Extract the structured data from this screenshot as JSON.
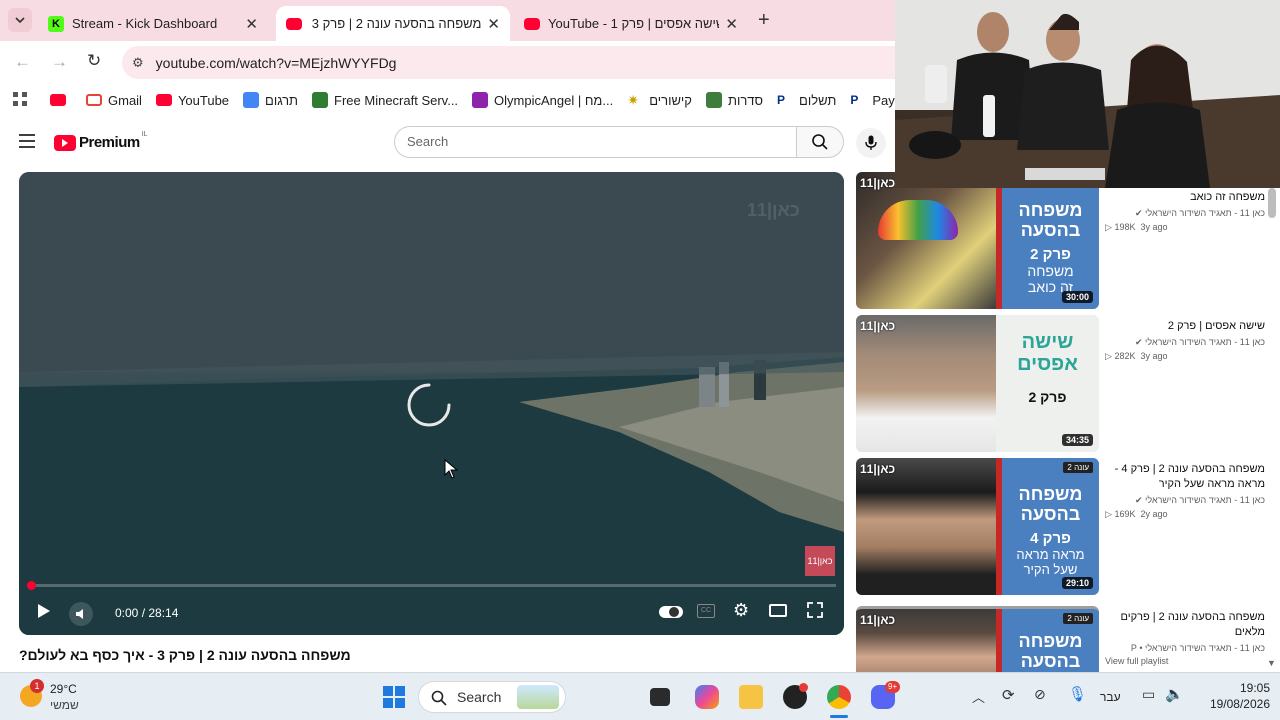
{
  "browser": {
    "tabs": [
      {
        "title": "Stream - Kick Dashboard",
        "color": "#53fc18"
      },
      {
        "title": "משפחה בהסעה עונה 2 | פרק 3",
        "color": "#ff0033"
      },
      {
        "title": "YouTube - שישה אפסים | פרק 1",
        "color": "#ff0033"
      }
    ],
    "url": "youtube.com/watch?v=MEjzhWYYFDg",
    "bookmarks": [
      {
        "label": "",
        "color": "#ff0033"
      },
      {
        "label": "Gmail",
        "color": "#ea4335"
      },
      {
        "label": "YouTube",
        "color": "#ff0033"
      },
      {
        "label": "תרגום",
        "color": "#4285f4"
      },
      {
        "label": "Free Minecraft Serv...",
        "color": "#2e7d32"
      },
      {
        "label": "OlympicAngel | מח...",
        "color": "#8e24aa"
      },
      {
        "label": "קישורים",
        "color": "#c8a200"
      },
      {
        "label": "סדרות",
        "color": "#3f7d3f"
      },
      {
        "label": "תשלום",
        "color": "#003087"
      },
      {
        "label": "Payl",
        "color": "#003087"
      }
    ]
  },
  "youtube": {
    "logo": "Premium",
    "logo_region": "IL",
    "search_placeholder": "Search",
    "player": {
      "time": "0:00 / 28:14",
      "watermark": "כאן|11",
      "corner_badge": "כאן|11"
    },
    "video_title": "משפחה בהסעה עונה 2 | פרק 3 - איך כסף בא לעולם?",
    "related": [
      {
        "title": "משפחה זה כואב",
        "channel": "כאן 11 - תאגיד השידור הישראלי",
        "views": "198K",
        "age": "3y ago",
        "duration": "30:00",
        "thumb_text": [
          "משפחה",
          "בהסעה",
          "פרק 2",
          "משפחה",
          "זה כואב"
        ],
        "badge": "",
        "logo": "כאן|11"
      },
      {
        "title": "שישה אפסים | פרק 2",
        "channel": "כאן 11 - תאגיד השידור הישראלי",
        "views": "282K",
        "age": "3y ago",
        "duration": "34:35",
        "thumb_text": [
          "שישה",
          "אפסים",
          "פרק 2"
        ],
        "badge": "",
        "logo": "כאן|11"
      },
      {
        "title": "משפחה בהסעה עונה 2 | פרק 4 - מראה מראה שעל הקיר",
        "channel": "כאן 11 - תאגיד השידור הישראלי",
        "views": "169K",
        "age": "2y ago",
        "duration": "29:10",
        "thumb_text": [
          "משפחה",
          "בהסעה",
          "פרק 4",
          "מראה מראה",
          "שעל הקיר"
        ],
        "badge": "עונה 2",
        "logo": "כאן|11"
      },
      {
        "title": "משפחה בהסעה עונה 2 | פרקים מלאים",
        "channel": "כאן 11 - תאגיד השידור הישראלי • P",
        "views": "",
        "age": "",
        "duration": "",
        "thumb_text": [
          "משפחה",
          "בהסעה"
        ],
        "badge": "עונה 2",
        "logo": "כאן|11",
        "footer": "View full playlist"
      }
    ]
  },
  "taskbar": {
    "weather_temp": "29°C",
    "weather_desc": "שמשי",
    "weather_alert": "1",
    "search_label": "Search",
    "lang": "עבר",
    "time": "19:05",
    "date": "19/08/2026",
    "discord_badge": "9+"
  }
}
